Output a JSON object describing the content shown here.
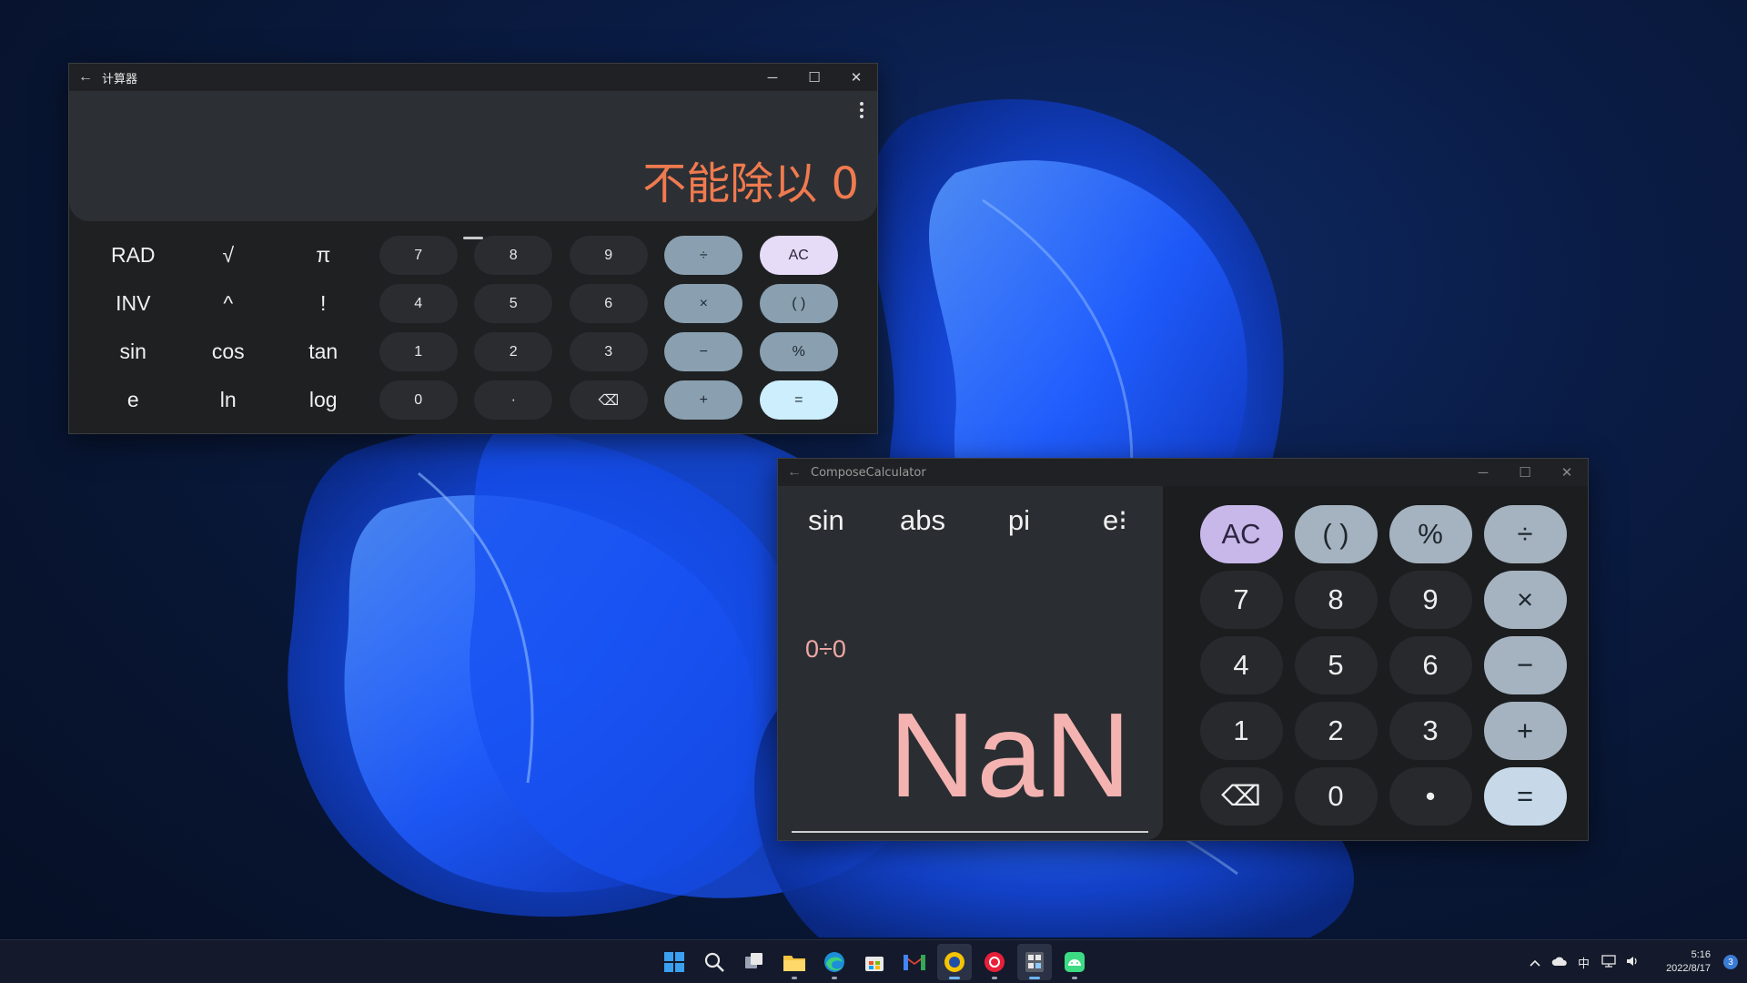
{
  "window_calculator": {
    "title": "计算器",
    "back": "←",
    "controls": [
      "─",
      "☐",
      "✕"
    ],
    "result": "不能除以 0",
    "scientific": [
      "RAD",
      "√",
      "π",
      "INV",
      "^",
      "!",
      "sin",
      "cos",
      "tan",
      "e",
      "ln",
      "log"
    ],
    "numbers": [
      "7",
      "8",
      "9",
      "4",
      "5",
      "6",
      "1",
      "2",
      "3",
      "0",
      "·",
      "⌫"
    ],
    "operators": [
      "÷",
      "×",
      "−",
      "+"
    ],
    "functions": [
      "AC",
      "( )",
      "%",
      "="
    ]
  },
  "window_compose": {
    "title": "ComposeCalculator",
    "back": "←",
    "controls": [
      "─",
      "☐",
      "✕"
    ],
    "scientific": [
      "sin",
      "abs",
      "pi",
      "e⁝"
    ],
    "expression": "0÷0",
    "result": "NaN",
    "keys": [
      "AC",
      "( )",
      "%",
      "÷",
      "7",
      "8",
      "9",
      "×",
      "4",
      "5",
      "6",
      "−",
      "1",
      "2",
      "3",
      "+",
      "⌫",
      "0",
      "•",
      "="
    ]
  },
  "taskbar": {
    "apps": [
      "start-icon",
      "search-icon",
      "task-view-icon",
      "file-explorer-icon",
      "edge-icon",
      "store-icon",
      "gmail-icon",
      "norton-icon",
      "netease-music-icon",
      "calculator-app-icon",
      "android-app-icon"
    ],
    "tray": {
      "ime": "中",
      "time": "5:16",
      "date": "2022/8/17",
      "notification_count": "3"
    }
  },
  "colors": {
    "error_result": "#f07a4f",
    "nan_result": "#f4b3b1",
    "accent": "#6cb4f0"
  }
}
